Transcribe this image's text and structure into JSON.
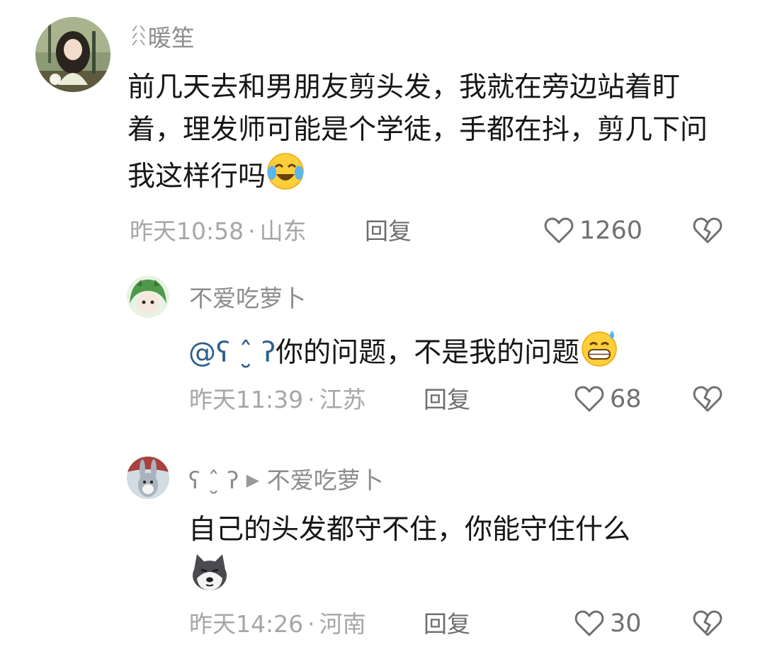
{
  "comments": [
    {
      "username": "暖笙",
      "username_prefix_icon": "music-note-icon",
      "text": "前几天去和男朋友剪头发，我就在旁边站着盯着，理发师可能是个学徒，手都在抖，剪几下问我这样行吗",
      "emoji": "crying-laughing-face",
      "time": "昨天10:58",
      "location": "山东",
      "reply_label": "回复",
      "likes": "1260"
    },
    {
      "username": "不爱吃萝卜",
      "mention": "@ʕ ˆ̮ ʔ",
      "text": "你的问题，不是我的问题",
      "emoji": "grinning-sweat-face",
      "time": "昨天11:39",
      "location": "江苏",
      "reply_label": "回复",
      "likes": "68"
    },
    {
      "username": "ʕ ˆ̮ ʔ",
      "reply_to": "不爱吃萝卜",
      "text": "自己的头发都守不住，你能守住什么",
      "emoji": "husky-dog-face",
      "time": "昨天14:26",
      "location": "河南",
      "reply_label": "回复",
      "likes": "30"
    }
  ],
  "separator": "·",
  "colors": {
    "meta": "#a6a6a6",
    "mention": "#2e5f8a",
    "text": "#161616"
  }
}
